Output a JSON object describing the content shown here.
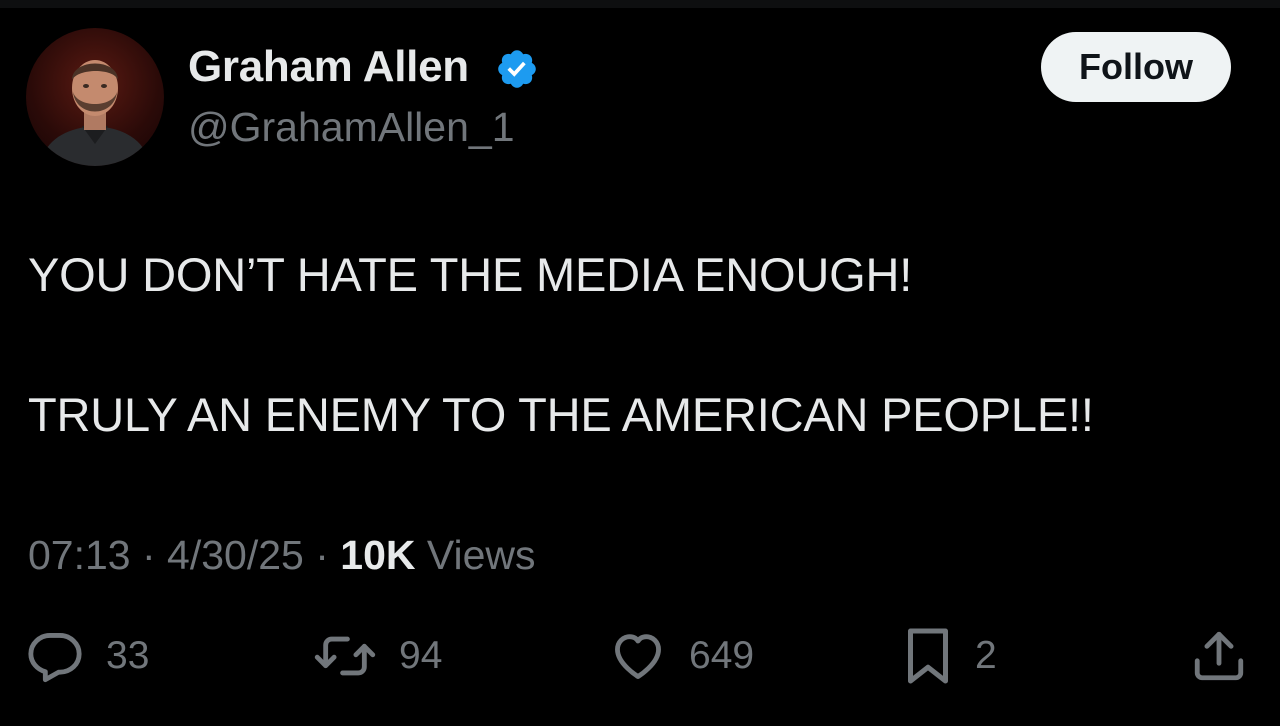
{
  "author": {
    "name": "Graham Allen",
    "handle": "@GrahamAllen_1",
    "verified": true,
    "avatar_icon": "profile-photo"
  },
  "follow_label": "Follow",
  "tweet": {
    "lines": [
      "YOU DON’T HATE THE MEDIA ENOUGH!",
      "TRULY AN ENEMY TO THE AMERICAN PEOPLE!!"
    ]
  },
  "meta": {
    "time": "07:13",
    "separator": " · ",
    "date": "4/30/25",
    "views_count": "10K",
    "views_label": " Views"
  },
  "actions": {
    "replies": "33",
    "reposts": "94",
    "likes": "649",
    "bookmarks": "2"
  },
  "colors": {
    "background": "#000000",
    "text_primary": "#e7e9ea",
    "text_secondary": "#71767b",
    "verified_blue": "#1d9bf0",
    "follow_bg": "#eff3f4"
  }
}
